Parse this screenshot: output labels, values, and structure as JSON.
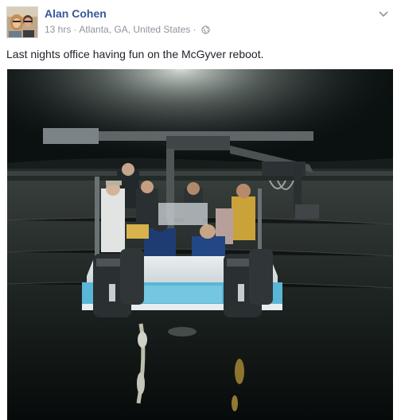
{
  "post": {
    "author": "Alan Cohen",
    "time": "13 hrs",
    "separator": "·",
    "location": "Atlanta, GA, United States",
    "privacy_icon": "globe-icon",
    "menu_icon": "chevron-down-icon",
    "text": "Last nights office having fun on the McGyver reboot."
  },
  "colors": {
    "author_link": "#365899",
    "meta_text": "#90949c",
    "body_text": "#1d2129"
  }
}
